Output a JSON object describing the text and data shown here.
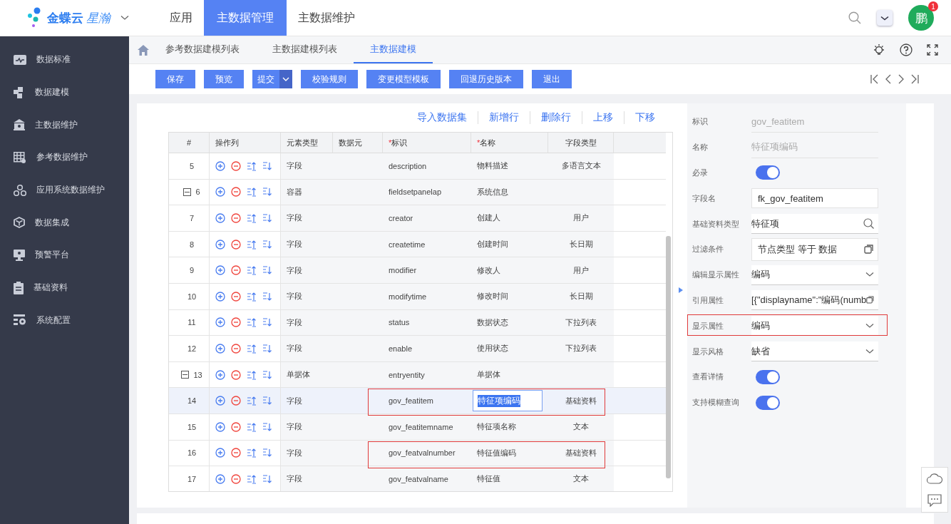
{
  "header": {
    "brand": "金蝶云",
    "brand_sub": "星瀚",
    "nav": [
      {
        "label": "应用",
        "selected": false
      },
      {
        "label": "主数据管理",
        "selected": true
      },
      {
        "label": "主数据维护",
        "selected": false
      }
    ],
    "avatar": "鹏",
    "badge": "1"
  },
  "sidebar": {
    "items": [
      {
        "label": "数据标准"
      },
      {
        "label": "数据建模"
      },
      {
        "label": "主数据维护"
      },
      {
        "label": "参考数据维护"
      },
      {
        "label": "应用系统数据维护"
      },
      {
        "label": "数据集成"
      },
      {
        "label": "预警平台"
      },
      {
        "label": "基础资料"
      },
      {
        "label": "系统配置"
      }
    ]
  },
  "breadcrumb": [
    {
      "label": "参考数据建模列表",
      "selected": false
    },
    {
      "label": "主数据建模列表",
      "selected": false
    },
    {
      "label": "主数据建模",
      "selected": true
    }
  ],
  "toolbar": [
    {
      "label": "保存",
      "dropdown": false
    },
    {
      "label": "预览",
      "dropdown": false
    },
    {
      "label": "提交",
      "dropdown": true
    },
    {
      "label": "校验规则",
      "dropdown": false
    },
    {
      "label": "变更模型模板",
      "dropdown": false
    },
    {
      "label": "回退历史版本",
      "dropdown": false
    },
    {
      "label": "退出",
      "dropdown": false
    }
  ],
  "table_actions": [
    "导入数据集",
    "新增行",
    "删除行",
    "上移",
    "下移"
  ],
  "table": {
    "columns": [
      {
        "label": "#"
      },
      {
        "label": "操作列"
      },
      {
        "label": "元素类型"
      },
      {
        "label": "数据元"
      },
      {
        "label": "标识",
        "required_mark": "*"
      },
      {
        "label": "名称",
        "required_mark": "*"
      },
      {
        "label": "字段类型"
      }
    ],
    "rows": [
      {
        "num": "5",
        "expandable": false,
        "type": "字段",
        "id": "description",
        "name": "物料描述",
        "field_type": "多语言文本",
        "selected": false,
        "editing": false,
        "marked": false
      },
      {
        "num": "6",
        "expandable": true,
        "type": "容器",
        "id": "fieldsetpanelap",
        "name": "系统信息",
        "selected": false,
        "editing": false,
        "marked": false
      },
      {
        "num": "7",
        "expandable": false,
        "type": "字段",
        "id": "creator",
        "name": "创建人",
        "field_type": "用户",
        "selected": false,
        "editing": false,
        "marked": false
      },
      {
        "num": "8",
        "expandable": false,
        "type": "字段",
        "id": "createtime",
        "name": "创建时间",
        "field_type": "长日期",
        "selected": false,
        "editing": false,
        "marked": false
      },
      {
        "num": "9",
        "expandable": false,
        "type": "字段",
        "id": "modifier",
        "name": "修改人",
        "field_type": "用户",
        "selected": false,
        "editing": false,
        "marked": false
      },
      {
        "num": "10",
        "expandable": false,
        "type": "字段",
        "id": "modifytime",
        "name": "修改时间",
        "field_type": "长日期",
        "selected": false,
        "editing": false,
        "marked": false
      },
      {
        "num": "11",
        "expandable": false,
        "type": "字段",
        "id": "status",
        "name": "数据状态",
        "field_type": "下拉列表",
        "selected": false,
        "editing": false,
        "marked": false
      },
      {
        "num": "12",
        "expandable": false,
        "type": "字段",
        "id": "enable",
        "name": "使用状态",
        "field_type": "下拉列表",
        "selected": false,
        "editing": false,
        "marked": false
      },
      {
        "num": "13",
        "expandable": true,
        "type": "单据体",
        "id": "entryentity",
        "name": "单据体",
        "selected": false,
        "editing": false,
        "marked": false
      },
      {
        "num": "14",
        "expandable": false,
        "type": "字段",
        "id": "gov_featitem",
        "name": "特征项编码",
        "field_type": "基础资料",
        "selected": true,
        "editing": true,
        "marked": true
      },
      {
        "num": "15",
        "expandable": false,
        "type": "字段",
        "id": "gov_featitemname",
        "name": "特征项名称",
        "field_type": "文本",
        "selected": false,
        "editing": false,
        "marked": false
      },
      {
        "num": "16",
        "expandable": false,
        "type": "字段",
        "id": "gov_featvalnumber",
        "name": "特征值编码",
        "field_type": "基础资料",
        "selected": false,
        "editing": false,
        "marked": true
      },
      {
        "num": "17",
        "expandable": false,
        "type": "字段",
        "id": "gov_featvalname",
        "name": "特征值",
        "field_type": "文本",
        "selected": false,
        "editing": false,
        "marked": false
      }
    ]
  },
  "properties": [
    {
      "label": "标识",
      "kind": "readonly",
      "value": "gov_featitem",
      "marked": false
    },
    {
      "label": "名称",
      "kind": "readonly",
      "value": "特征项编码",
      "marked": false
    },
    {
      "label": "必录",
      "kind": "toggle",
      "on": true,
      "marked": false
    },
    {
      "label": "字段名",
      "kind": "input",
      "value": "fk_gov_featitem",
      "marked": false
    },
    {
      "label": "基础资料类型",
      "kind": "lookup",
      "value": "特征项",
      "marked": false
    },
    {
      "label": "过滤条件",
      "kind": "boxed",
      "value": "节点类型 等于 数据",
      "marked": false
    },
    {
      "label": "编辑显示属性",
      "kind": "select",
      "value": "编码",
      "marked": false
    },
    {
      "label": "引用属性",
      "kind": "copy",
      "value": "[{\"displayname\":\"编码(numb",
      "marked": false
    },
    {
      "label": "显示属性",
      "kind": "select",
      "value": "编码",
      "marked": true
    },
    {
      "label": "显示风格",
      "kind": "select",
      "value": "缺省",
      "marked": false
    },
    {
      "label": "查看详情",
      "kind": "toggle",
      "on": true,
      "marked": false
    },
    {
      "label": "支持模糊查询",
      "kind": "toggle",
      "on": true,
      "marked": false
    }
  ]
}
